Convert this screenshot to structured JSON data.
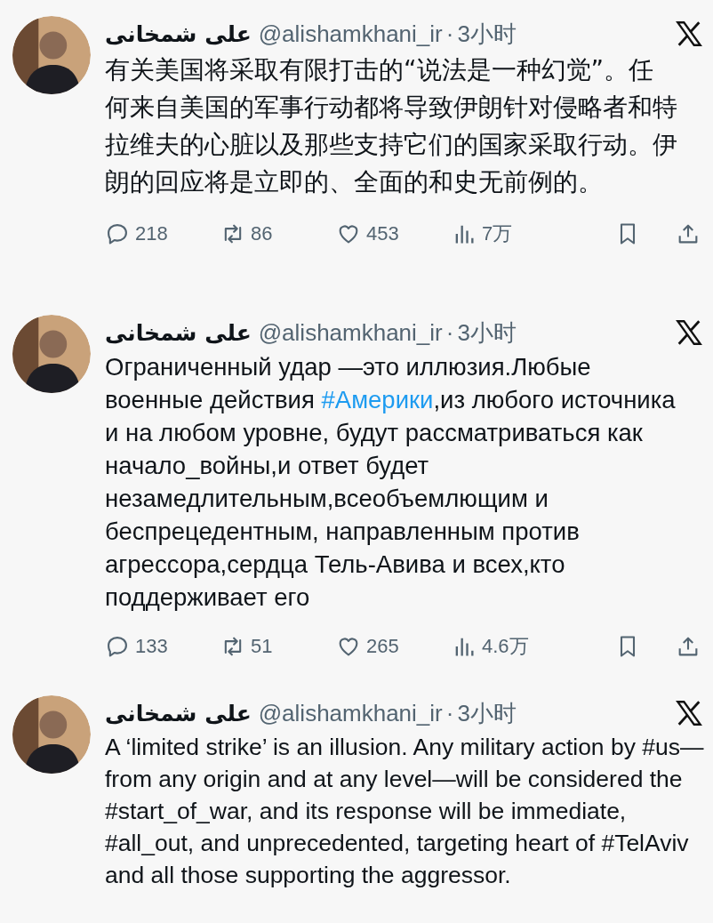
{
  "tweets": [
    {
      "author": {
        "name": "علی شمخانی",
        "handle": "@alishamkhani_ir",
        "separator": "·",
        "time": "3小时"
      },
      "body": [
        {
          "kind": "text",
          "text": "有关美国将采取有限打击的“说法是一种幻觉”。任何来自美国的军事行动都将导致伊朗针对侵略者和特拉维夫的心脏以及那些支持它们的国家采取行动。伊朗的回应将是立即的、全面的和史无前例的。"
        }
      ],
      "stats": {
        "replies": "218",
        "reposts": "86",
        "likes": "453",
        "views": "7万"
      }
    },
    {
      "author": {
        "name": "علی شمخانی",
        "handle": "@alishamkhani_ir",
        "separator": "·",
        "time": "3小时"
      },
      "body": [
        {
          "kind": "text",
          "text": "Ограниченный удар —это иллюзия.Любые военные действия "
        },
        {
          "kind": "hashtag",
          "text": "#Америки"
        },
        {
          "kind": "text",
          "text": ",из любого источника и на любом уровне, будут рассматриваться как начало_войны,и ответ будет незамедлительным,всеобъемлющим и беспрецедентным, направленным против агрессора,сердца Тель-Авива и всех,кто поддерживает его"
        }
      ],
      "stats": {
        "replies": "133",
        "reposts": "51",
        "likes": "265",
        "views": "4.6万"
      }
    },
    {
      "author": {
        "name": "علی شمخانی",
        "handle": "@alishamkhani_ir",
        "separator": "·",
        "time": "3小时"
      },
      "body": [
        {
          "kind": "text",
          "text": "A ‘limited strike’ is an illusion. Any military action by #us—from any origin and at any level—will be considered the #start_of_war, and its response will be immediate, #all_out, and unprecedented, targeting heart of #TelAviv and all those supporting the aggressor."
        }
      ]
    }
  ]
}
